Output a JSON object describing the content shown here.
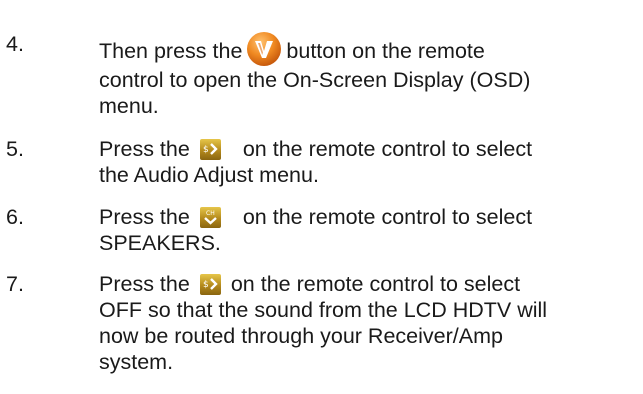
{
  "steps": [
    {
      "number": "4.",
      "before": "Then press the",
      "icon": "vizio-menu-button-icon",
      "after": "button on the remote",
      "continuation": [
        "control to open the On-Screen Display (OSD)",
        "menu."
      ]
    },
    {
      "number": "5.",
      "before": "Press the",
      "icon": "volume-right-icon",
      "after": "on the remote control to select",
      "continuation": [
        "the Audio Adjust menu."
      ]
    },
    {
      "number": "6.",
      "before": "Press the",
      "icon": "channel-down-icon",
      "after": "on the remote control to select",
      "continuation": [
        "SPEAKERS."
      ]
    },
    {
      "number": "7.",
      "before": "Press the",
      "icon": "volume-right-icon",
      "after": "on the remote control to select",
      "continuation": [
        "OFF so that the sound from the LCD HDTV will",
        "now be routed through your Receiver/Amp",
        "system."
      ]
    }
  ],
  "colors": {
    "menu_button": "#e87a1a",
    "remote_key": "#c49a28",
    "text": "#1a1a1a"
  }
}
